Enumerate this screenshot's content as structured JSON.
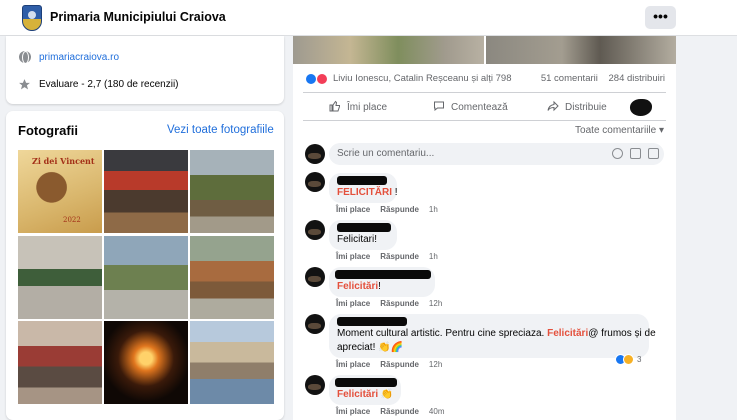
{
  "header": {
    "page_name": "Primaria Municipiului Craiova",
    "more_label": "•••"
  },
  "info": {
    "website": "primariacraiova.ro",
    "rating": "Evaluare - 2,7 (180 de recenzii)"
  },
  "photos": {
    "title": "Fotografii",
    "see_all": "Vezi toate fotografiile",
    "poster_title": "Zi dei Vincent",
    "poster_date": "2022"
  },
  "post": {
    "reactions": {
      "names": "Liviu Ionescu, Catalin Reșceanu și alți 798",
      "comments": "51 comentarii",
      "shares": "284 distribuiri"
    },
    "actions": {
      "like": "Îmi place",
      "comment": "Comentează",
      "share": "Distribuie"
    },
    "sort_label": "Toate comentariile ▾",
    "composer_placeholder": "Scrie un comentariu..."
  },
  "comments": [
    {
      "pre": "",
      "highlight": "FELICITĂRI",
      "post": " !",
      "like": "Îmi place",
      "reply": "Răspunde",
      "time": "1h"
    },
    {
      "pre": "Felicitari!",
      "highlight": "",
      "post": "",
      "like": "Îmi place",
      "reply": "Răspunde",
      "time": "1h"
    },
    {
      "pre": "",
      "highlight": "Felicitări",
      "post": "!",
      "like": "Îmi place",
      "reply": "Răspunde",
      "time": "12h"
    },
    {
      "line1_pre": "Moment cultural artistic. Pentru cine spreciaza. ",
      "line1_highlight": "Felicitări",
      "line1_post": "@ frumos și de",
      "line2": "apreciat! 👏🌈",
      "like": "Îmi place",
      "reply": "Răspunde",
      "time": "12h",
      "reaction_count": "3"
    },
    {
      "pre": "",
      "highlight": "Felicitări",
      "post": " 👏",
      "like": "Îmi place",
      "reply": "Răspunde",
      "time": "40m"
    }
  ],
  "colors": {
    "link": "#216fdb",
    "highlight": "#e4503c",
    "background": "#f0f2f5"
  }
}
